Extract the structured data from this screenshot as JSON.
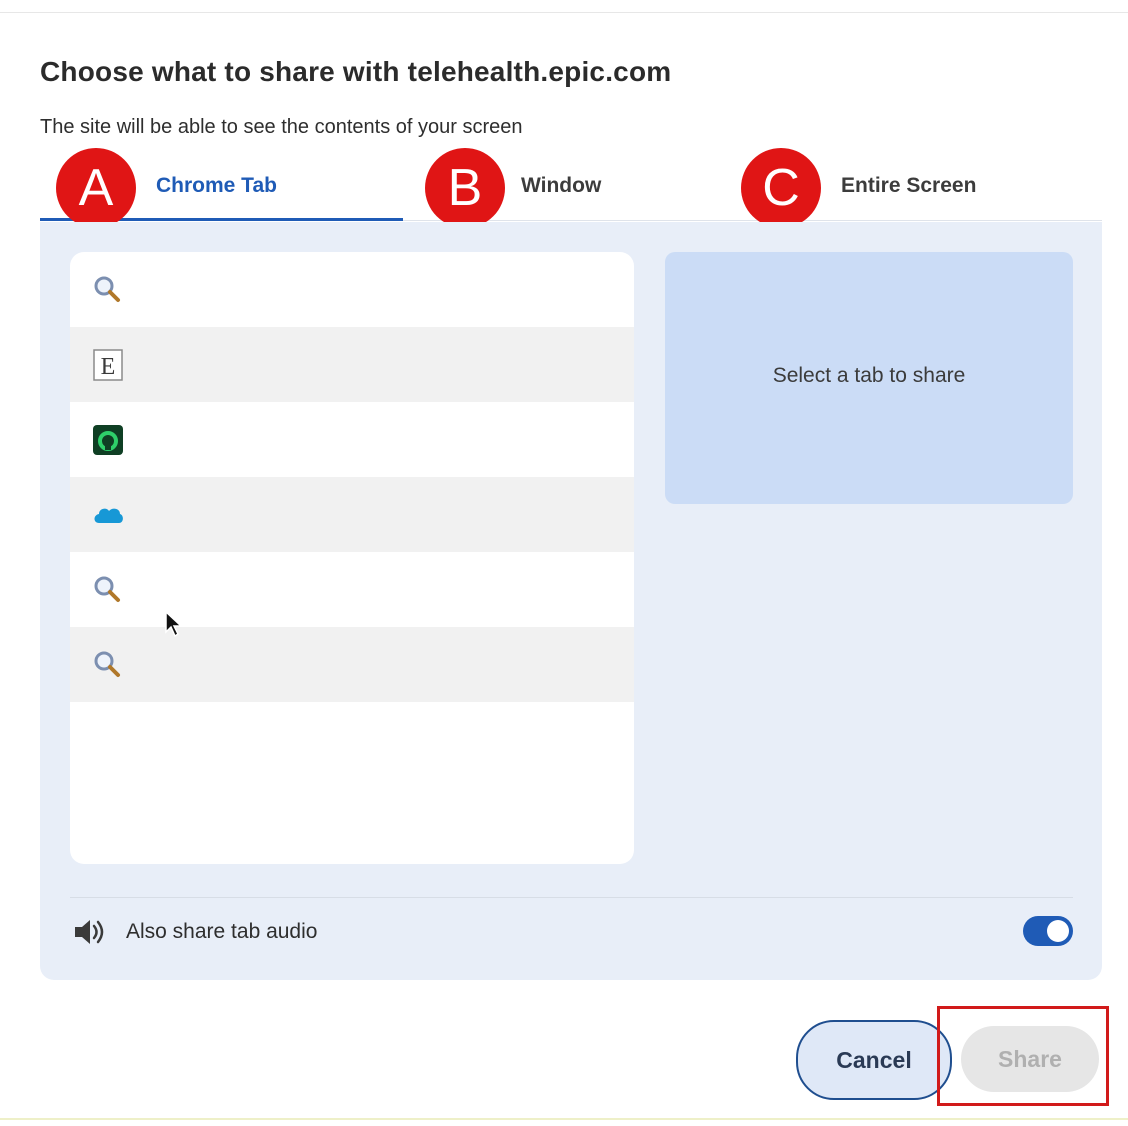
{
  "dialog": {
    "title": "Choose what to share with telehealth.epic.com",
    "subtitle": "The site will be able to see the contents of your screen"
  },
  "tabs": [
    {
      "label": "Chrome Tab",
      "badge": "A",
      "active": true
    },
    {
      "label": "Window",
      "badge": "B",
      "active": false
    },
    {
      "label": "Entire Screen",
      "badge": "C",
      "active": false
    }
  ],
  "tab_list": [
    {
      "icon": "search-favicon-icon"
    },
    {
      "icon": "epic-e-favicon-icon"
    },
    {
      "icon": "green-app-favicon-icon"
    },
    {
      "icon": "salesforce-cloud-icon"
    },
    {
      "icon": "search-favicon-icon"
    },
    {
      "icon": "search-favicon-icon"
    }
  ],
  "preview": {
    "text": "Select a tab to share"
  },
  "audio": {
    "label": "Also share tab audio",
    "enabled": true
  },
  "buttons": {
    "cancel": "Cancel",
    "share": "Share"
  },
  "colors": {
    "accent": "#1f5bb6",
    "badge": "#e01515",
    "highlight": "#d11a1a",
    "panel": "#e8eef8",
    "preview": "#cbdcf6"
  }
}
